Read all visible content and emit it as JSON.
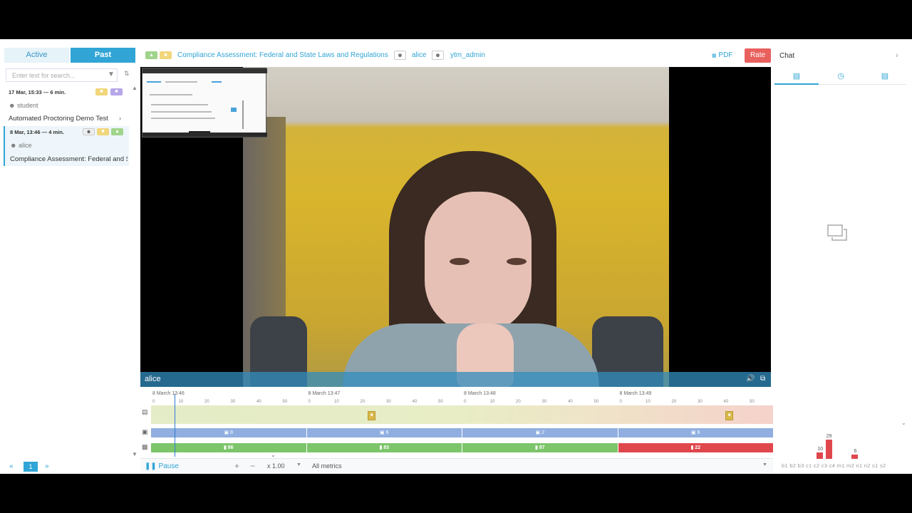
{
  "left": {
    "tabs": {
      "active": "Active",
      "past": "Past"
    },
    "search_placeholder": "Enter text for search...",
    "sessions": [
      {
        "date": "17 Mar, 15:33 — 6 min.",
        "user": "student",
        "title": "Automated Proctoring Demo Test"
      },
      {
        "date": "8 Mar, 13:46 — 4 min.",
        "user": "alice",
        "title": "Compliance Assessment: Federal and St"
      }
    ],
    "pager": {
      "first": "«",
      "page": "1",
      "last": "»"
    }
  },
  "header": {
    "exam_title": "Compliance Assessment: Federal and State Laws and Regulations",
    "student": "alice",
    "proctor": "ytm_admin",
    "pdf_label": "PDF",
    "rate_label": "Rate"
  },
  "video": {
    "user_label": "alice"
  },
  "chat": {
    "title": "Chat"
  },
  "timeline": {
    "segments": [
      "8 March 13:46",
      "8 March 13:47",
      "8 March 13:48",
      "8 March 13:49"
    ],
    "ticks": [
      "0",
      "10",
      "20",
      "30",
      "40",
      "50"
    ],
    "photo_counts": [
      "8",
      "6",
      "2",
      "6"
    ],
    "metric_scores": [
      "86",
      "83",
      "87",
      "22"
    ]
  },
  "controls": {
    "pause_label": "Pause",
    "speed_label": "x 1.00",
    "metrics_label": "All metrics"
  },
  "metrics_chart": {
    "labels": "b1 b2 b3 c1 c2 c3 c4 m1 m2 n1 n2 s1 s2",
    "bars": [
      {
        "metric": "c2",
        "value": 10
      },
      {
        "metric": "c3",
        "value": 29
      },
      {
        "metric": "m2",
        "value": 6
      }
    ]
  },
  "colors": {
    "accent": "#31a5d6",
    "rate": "#e9615e",
    "good": "#7cc56a",
    "bad": "#e0474c"
  }
}
